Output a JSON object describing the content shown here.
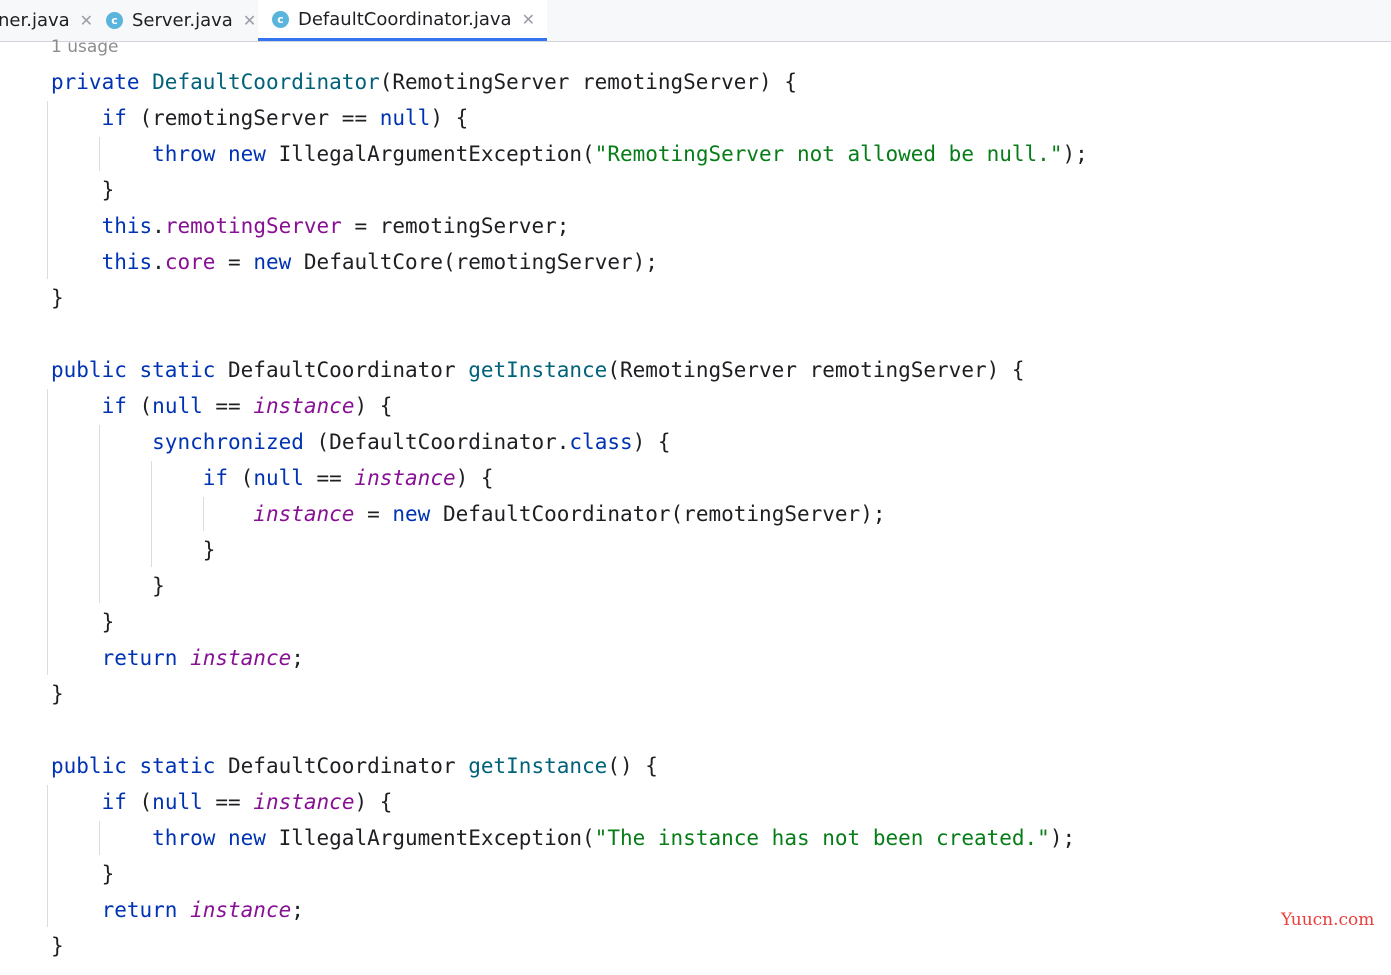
{
  "tabs": [
    {
      "label": "ner.java",
      "icon": "none",
      "active": false
    },
    {
      "label": "Server.java",
      "icon": "class-c-icon",
      "active": false
    },
    {
      "label": "DefaultCoordinator.java",
      "icon": "class-c-icon",
      "active": true
    }
  ],
  "tab_icon_letter": "c",
  "tab_close_glyph": "✕",
  "editor": {
    "usage_hint": "1 usage",
    "lines": [
      [
        [
          "kw",
          "private "
        ],
        [
          "fn",
          "DefaultCoordinator"
        ],
        [
          "",
          "(RemotingServer remotingServer) {"
        ]
      ],
      [
        [
          "",
          "    "
        ],
        [
          "kw",
          "if "
        ],
        [
          "",
          "(remotingServer == "
        ],
        [
          "kw",
          "null"
        ],
        [
          "",
          ") {"
        ]
      ],
      [
        [
          "",
          "        "
        ],
        [
          "kw",
          "throw new "
        ],
        [
          "",
          "IllegalArgumentException("
        ],
        [
          "str",
          "\"RemotingServer not allowed be null.\""
        ],
        [
          "",
          ");"
        ]
      ],
      [
        [
          "",
          "    }"
        ]
      ],
      [
        [
          "",
          "    "
        ],
        [
          "kw",
          "this"
        ],
        [
          "",
          "."
        ],
        [
          "fld",
          "remotingServer"
        ],
        [
          "",
          " = remotingServer;"
        ]
      ],
      [
        [
          "",
          "    "
        ],
        [
          "kw",
          "this"
        ],
        [
          "",
          "."
        ],
        [
          "fld",
          "core"
        ],
        [
          "",
          " = "
        ],
        [
          "kw",
          "new "
        ],
        [
          "",
          "DefaultCore(remotingServer);"
        ]
      ],
      [
        [
          "",
          "}"
        ]
      ],
      [],
      [
        [
          "kw",
          "public static "
        ],
        [
          "",
          "DefaultCoordinator "
        ],
        [
          "fn",
          "getInstance"
        ],
        [
          "",
          "(RemotingServer remotingServer) {"
        ]
      ],
      [
        [
          "",
          "    "
        ],
        [
          "kw",
          "if "
        ],
        [
          "",
          "("
        ],
        [
          "kw",
          "null"
        ],
        [
          "",
          " == "
        ],
        [
          "sfld",
          "instance"
        ],
        [
          "",
          ") {"
        ]
      ],
      [
        [
          "",
          "        "
        ],
        [
          "kw",
          "synchronized "
        ],
        [
          "",
          "(DefaultCoordinator."
        ],
        [
          "kw",
          "class"
        ],
        [
          "",
          ") {"
        ]
      ],
      [
        [
          "",
          "            "
        ],
        [
          "kw",
          "if "
        ],
        [
          "",
          "("
        ],
        [
          "kw",
          "null"
        ],
        [
          "",
          " == "
        ],
        [
          "sfld",
          "instance"
        ],
        [
          "",
          ") {"
        ]
      ],
      [
        [
          "",
          "                "
        ],
        [
          "sfld",
          "instance"
        ],
        [
          "",
          " = "
        ],
        [
          "kw",
          "new "
        ],
        [
          "",
          "DefaultCoordinator(remotingServer);"
        ]
      ],
      [
        [
          "",
          "            }"
        ]
      ],
      [
        [
          "",
          "        }"
        ]
      ],
      [
        [
          "",
          "    }"
        ]
      ],
      [
        [
          "",
          "    "
        ],
        [
          "kw",
          "return "
        ],
        [
          "sfld",
          "instance"
        ],
        [
          "",
          ";"
        ]
      ],
      [
        [
          "",
          "}"
        ]
      ],
      [],
      [
        [
          "kw",
          "public static "
        ],
        [
          "",
          "DefaultCoordinator "
        ],
        [
          "fn",
          "getInstance"
        ],
        [
          "",
          "() {"
        ]
      ],
      [
        [
          "",
          "    "
        ],
        [
          "kw",
          "if "
        ],
        [
          "",
          "("
        ],
        [
          "kw",
          "null"
        ],
        [
          "",
          " == "
        ],
        [
          "sfld",
          "instance"
        ],
        [
          "",
          ") {"
        ]
      ],
      [
        [
          "",
          "        "
        ],
        [
          "kw",
          "throw new "
        ],
        [
          "",
          "IllegalArgumentException("
        ],
        [
          "str",
          "\"The instance has not been created.\""
        ],
        [
          "",
          ");"
        ]
      ],
      [
        [
          "",
          "    }"
        ]
      ],
      [
        [
          "",
          "    "
        ],
        [
          "kw",
          "return "
        ],
        [
          "sfld",
          "instance"
        ],
        [
          "",
          ";"
        ]
      ],
      [
        [
          "",
          "}"
        ]
      ]
    ]
  },
  "watermark": "Yuucn.com",
  "colors": {
    "keyword": "#0033b3",
    "method": "#00627a",
    "field": "#871094",
    "string": "#067d17",
    "tab_active_underline": "#3574f0",
    "class_icon": "#5ab4dc",
    "watermark": "#e8403c"
  }
}
